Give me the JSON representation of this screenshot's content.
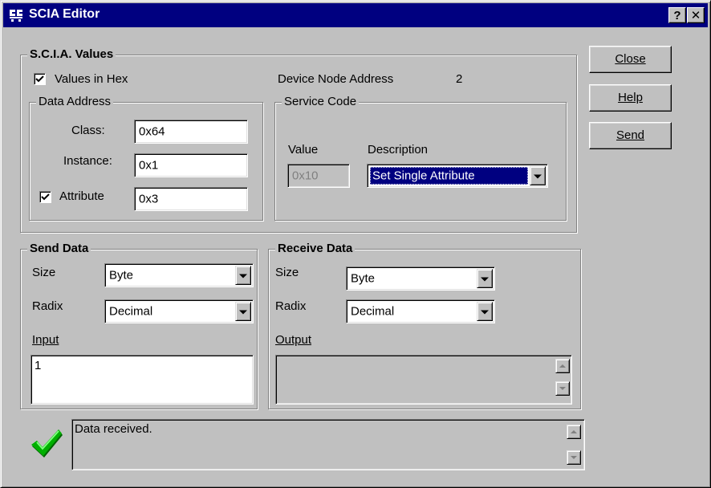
{
  "window": {
    "title": "SCIA Editor",
    "help_button": "?",
    "close_button": "✕"
  },
  "scia_values": {
    "group_title": "S.C.I.A. Values",
    "values_in_hex": {
      "label": "Values in Hex",
      "checked": true
    },
    "device_node_address_label": "Device Node Address",
    "device_node_address_value": "2",
    "data_address": {
      "group_title": "Data Address",
      "class_label": "Class:",
      "class_value": "0x64",
      "instance_label": "Instance:",
      "instance_value": "0x1",
      "attribute_label": "Attribute",
      "attribute_checked": true,
      "attribute_value": "0x3"
    },
    "service_code": {
      "group_title": "Service Code",
      "value_label": "Value",
      "value": "0x10",
      "description_label": "Description",
      "description_selected": "Set Single Attribute"
    }
  },
  "send_data": {
    "group_title": "Send Data",
    "size_label": "Size",
    "size_selected": "Byte",
    "radix_label": "Radix",
    "radix_selected": "Decimal",
    "input_label": "Input",
    "input_value": "1"
  },
  "receive_data": {
    "group_title": "Receive Data",
    "size_label": "Size",
    "size_selected": "Byte",
    "radix_label": "Radix",
    "radix_selected": "Decimal",
    "output_label": "Output",
    "output_value": ""
  },
  "buttons": {
    "close": "Close",
    "help": "Help",
    "send": "Send"
  },
  "status": {
    "icon": "checkmark-icon",
    "message": "Data received."
  },
  "colors": {
    "title_bar": "#000080",
    "face": "#c0c0c0",
    "check_green": "#00b000"
  }
}
